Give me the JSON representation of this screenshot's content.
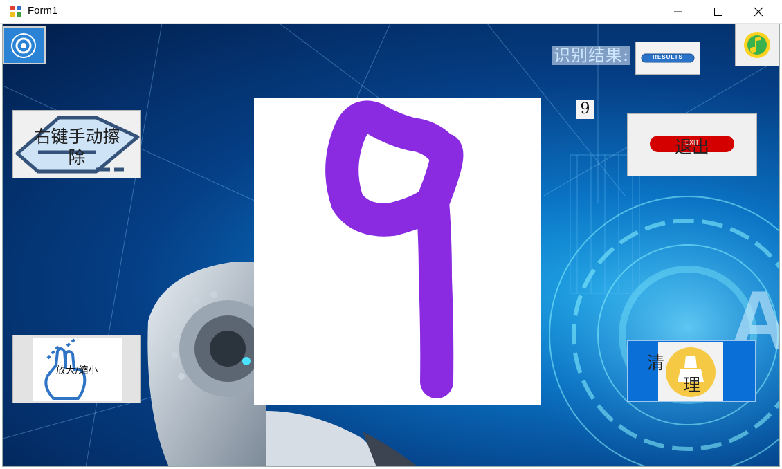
{
  "window": {
    "title": "Form1"
  },
  "result": {
    "label": "识别结果:",
    "value": "9",
    "results_badge": "RESULTS"
  },
  "buttons": {
    "erase": "右键手动擦除",
    "erase_line1": "右键手动擦",
    "erase_line2": "除",
    "zoom": "放大/缩小",
    "exit_line": "退出",
    "exit_badge": "EXIT",
    "clear_1": "清",
    "clear_2": "理"
  },
  "canvas": {
    "drawn_digit": "9",
    "stroke_color": "#8a2be2"
  },
  "icons": [
    "app-icon",
    "minimize-icon",
    "maximize-icon",
    "close-icon",
    "settings-icon",
    "music-icon",
    "results-icon",
    "exit-icon",
    "eraser-icon",
    "zoom-hand-icon",
    "broom-icon"
  ]
}
